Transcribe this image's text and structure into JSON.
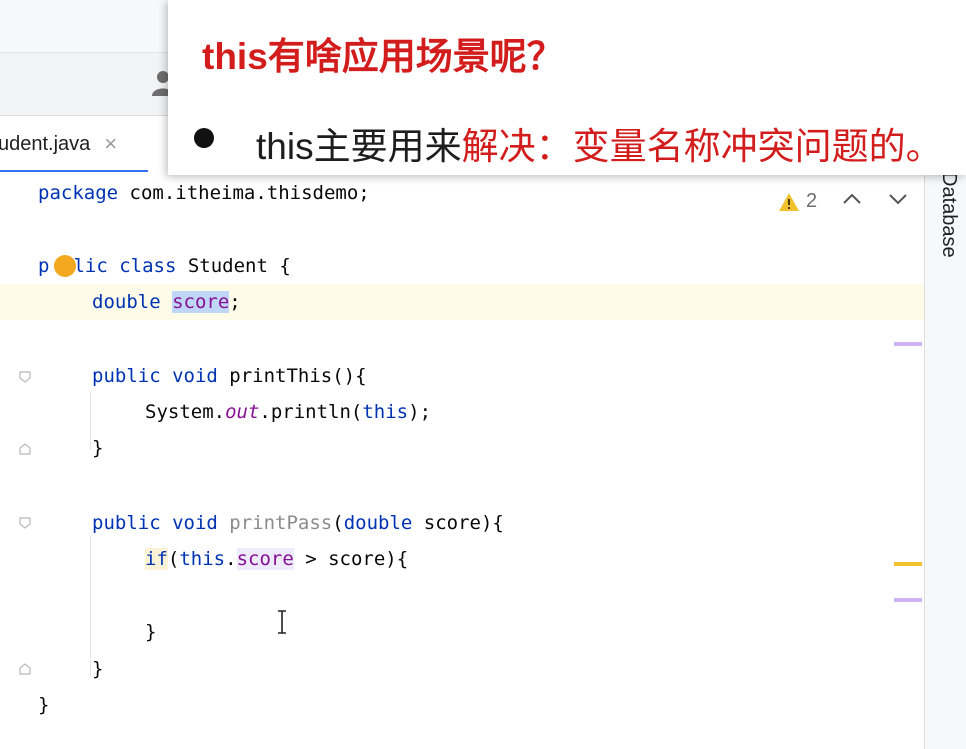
{
  "overlay": {
    "title": "this有啥应用场景呢？",
    "bullet_black": "this主要用来",
    "bullet_red": "解决：变量名称冲突问题的。"
  },
  "tab": {
    "label": "udent.java",
    "close": "×"
  },
  "side_panel": {
    "label": "Database"
  },
  "inspections": {
    "warning_count": "2",
    "up": "⌃",
    "down": "⌄"
  },
  "code": {
    "l1_kw": "package",
    "l1_rest": " com.itheima.thisdemo;",
    "l3_a": "p",
    "l3_b": "lic class",
    "l3_c": " Student {",
    "l4_kw": "double",
    "l4_field": "score",
    "l4_end": ";",
    "l6_kw": "public void",
    "l6_name": " printThis(){",
    "l7_a": "System.",
    "l7_out": "out",
    "l7_b": ".println(",
    "l7_this": "this",
    "l7_c": ");",
    "l8": "}",
    "l10_kw": "public void",
    "l10_name": " printPass",
    "l10_a": "(",
    "l10_kw2": "double",
    "l10_b": " score){",
    "l11_if": "if",
    "l11_a": "(",
    "l11_this": "this",
    "l11_dot": ".",
    "l11_field": "score",
    "l11_b": " > score){",
    "l13": "}",
    "l14": "}",
    "l15": "}"
  },
  "colors": {
    "keyword": "#0033b3",
    "field": "#871094",
    "accent_red": "#d31d1d",
    "tab_underline": "#3574f0",
    "marker_yellow": "#f2c12e",
    "marker_purple": "#cdb3f0"
  },
  "icons": [
    "user-icon",
    "close-icon",
    "lightbulb-icon",
    "warning-icon",
    "chevron-up-icon",
    "chevron-down-icon",
    "text-cursor-icon"
  ]
}
